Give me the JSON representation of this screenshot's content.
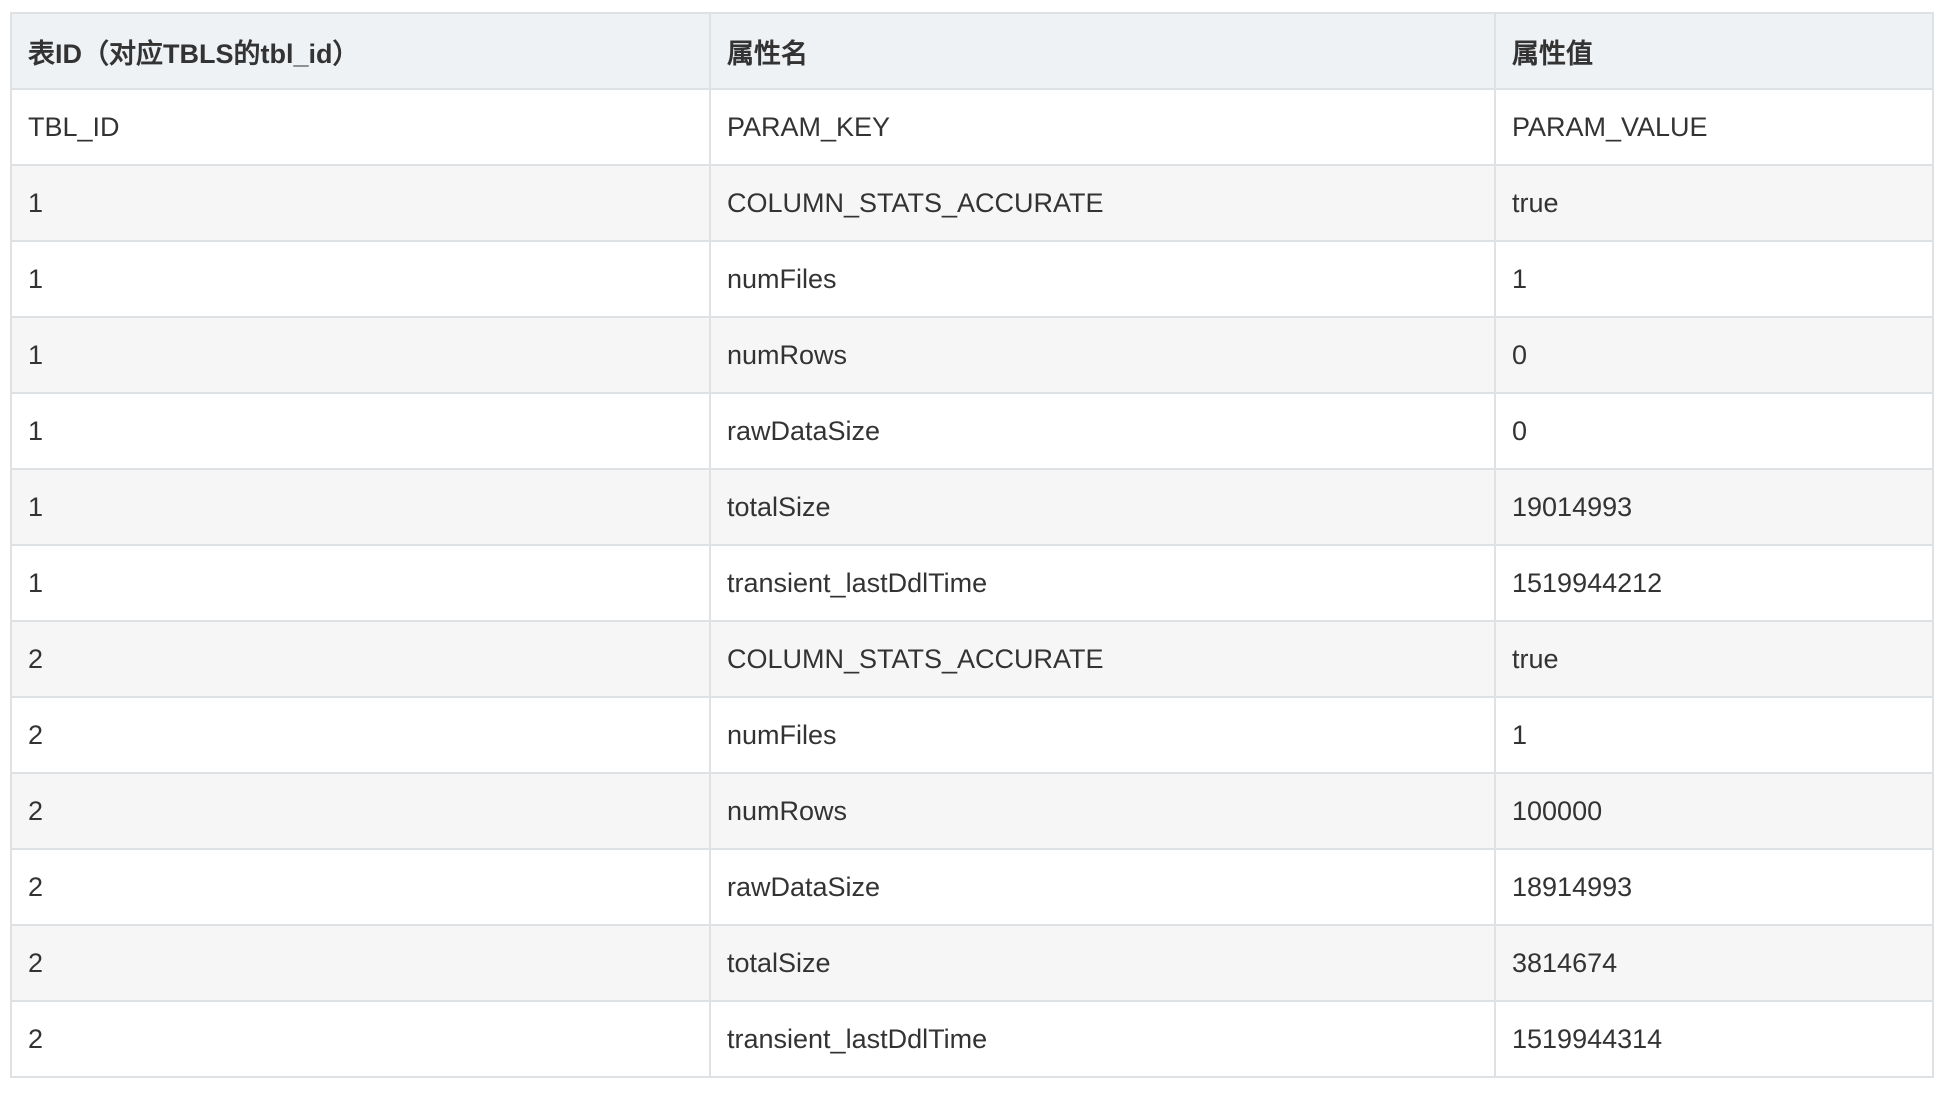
{
  "table": {
    "headers": [
      "表ID（对应TBLS的tbl_id）",
      "属性名",
      "属性值"
    ],
    "rows": [
      [
        "TBL_ID",
        "PARAM_KEY",
        "PARAM_VALUE"
      ],
      [
        "1",
        "COLUMN_STATS_ACCURATE",
        "true"
      ],
      [
        "1",
        "numFiles",
        "1"
      ],
      [
        "1",
        "numRows",
        "0"
      ],
      [
        "1",
        "rawDataSize",
        "0"
      ],
      [
        "1",
        "totalSize",
        "19014993"
      ],
      [
        "1",
        "transient_lastDdlTime",
        "1519944212"
      ],
      [
        "2",
        "COLUMN_STATS_ACCURATE",
        "true"
      ],
      [
        "2",
        "numFiles",
        "1"
      ],
      [
        "2",
        "numRows",
        "100000"
      ],
      [
        "2",
        "rawDataSize",
        "18914993"
      ],
      [
        "2",
        "totalSize",
        "3814674"
      ],
      [
        "2",
        "transient_lastDdlTime",
        "1519944314"
      ]
    ]
  },
  "colors": {
    "header_bg": "#eef2f5",
    "border": "#dfe2e5",
    "stripe_bg": "#f6f6f6",
    "text": "#333333"
  }
}
